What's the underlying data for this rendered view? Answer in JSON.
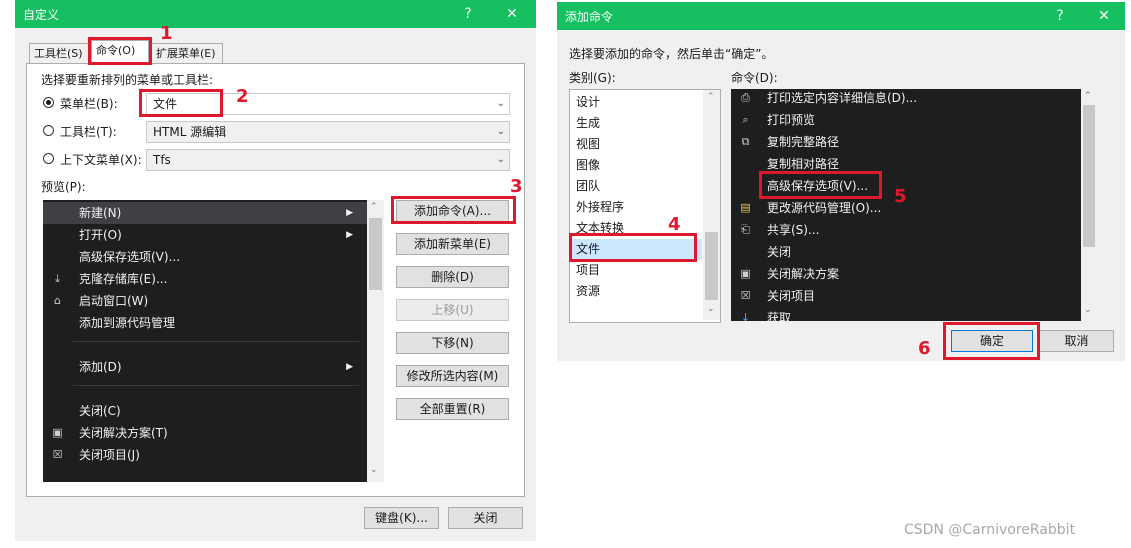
{
  "dialog1": {
    "title": "自定义",
    "help_glyph": "?",
    "close_glyph": "✕",
    "tabs": [
      "工具栏(S)",
      "命令(O)",
      "扩展菜单(E)"
    ],
    "instruction": "选择要重新排列的菜单或工具栏:",
    "radio_menubar": "菜单栏(B):",
    "radio_toolbar": "工具栏(T):",
    "radio_context": "上下文菜单(X):",
    "menubar_value": "文件",
    "toolbar_value": "HTML 源编辑",
    "context_value": "Tfs",
    "preview_label": "预览(P):",
    "preview_items": [
      {
        "label": "新建(N)",
        "icon": "",
        "sub": true
      },
      {
        "label": "打开(O)",
        "icon": "",
        "sub": true
      },
      {
        "label": "高级保存选项(V)...",
        "icon": "",
        "sub": false
      },
      {
        "label": "克隆存储库(E)...",
        "icon": "download-icon",
        "sub": false
      },
      {
        "label": "启动窗口(W)",
        "icon": "home-window-icon",
        "sub": false
      },
      {
        "label": "添加到源代码管理",
        "icon": "",
        "sub": false
      },
      {
        "label": "添加(D)",
        "icon": "",
        "sub": true
      },
      {
        "label": "关闭(C)",
        "icon": "",
        "sub": false
      },
      {
        "label": "关闭解决方案(T)",
        "icon": "close-solution-icon",
        "sub": false
      },
      {
        "label": "关闭项目(J)",
        "icon": "close-project-icon",
        "sub": false
      }
    ],
    "buttons": {
      "add_command": "添加命令(A)...",
      "add_menu": "添加新菜单(E)",
      "delete": "删除(D)",
      "move_up": "上移(U)",
      "move_down": "下移(N)",
      "modify": "修改所选内容(M)",
      "reset_all": "全部重置(R)",
      "keyboard": "键盘(K)...",
      "close": "关闭"
    }
  },
  "dialog2": {
    "title": "添加命令",
    "help_glyph": "?",
    "close_glyph": "✕",
    "instruction": "选择要添加的命令，然后单击“确定”。",
    "category_label": "类别(G):",
    "command_label": "命令(D):",
    "categories": [
      "设计",
      "生成",
      "视图",
      "图像",
      "团队",
      "外接程序",
      "文本转换",
      "文件",
      "项目",
      "资源"
    ],
    "selected_category": "文件",
    "commands": [
      {
        "label": "打印选定内容详细信息(D)...",
        "icon": "printer-icon"
      },
      {
        "label": "打印预览",
        "icon": "print-preview-icon"
      },
      {
        "label": "复制完整路径",
        "icon": "copy-path-icon"
      },
      {
        "label": "复制相对路径",
        "icon": ""
      },
      {
        "label": "高级保存选项(V)...",
        "icon": ""
      },
      {
        "label": "更改源代码管理(O)...",
        "icon": "source-control-icon"
      },
      {
        "label": "共享(S)...",
        "icon": "share-icon"
      },
      {
        "label": "关闭",
        "icon": ""
      },
      {
        "label": "关闭解决方案",
        "icon": "close-solution-icon"
      },
      {
        "label": "关闭项目",
        "icon": "close-project-icon"
      },
      {
        "label": "获取",
        "icon": "get-icon"
      }
    ],
    "ok": "确定",
    "cancel": "取消"
  },
  "annotations": [
    "1",
    "2",
    "3",
    "4",
    "5",
    "6"
  ],
  "watermark": "CSDN @CarnivoreRabbit",
  "colors": {
    "titlebar": "#16c060",
    "highlight": "#e0182d",
    "dark_list": "#1e1e1e",
    "selection": "#cce8ff"
  }
}
